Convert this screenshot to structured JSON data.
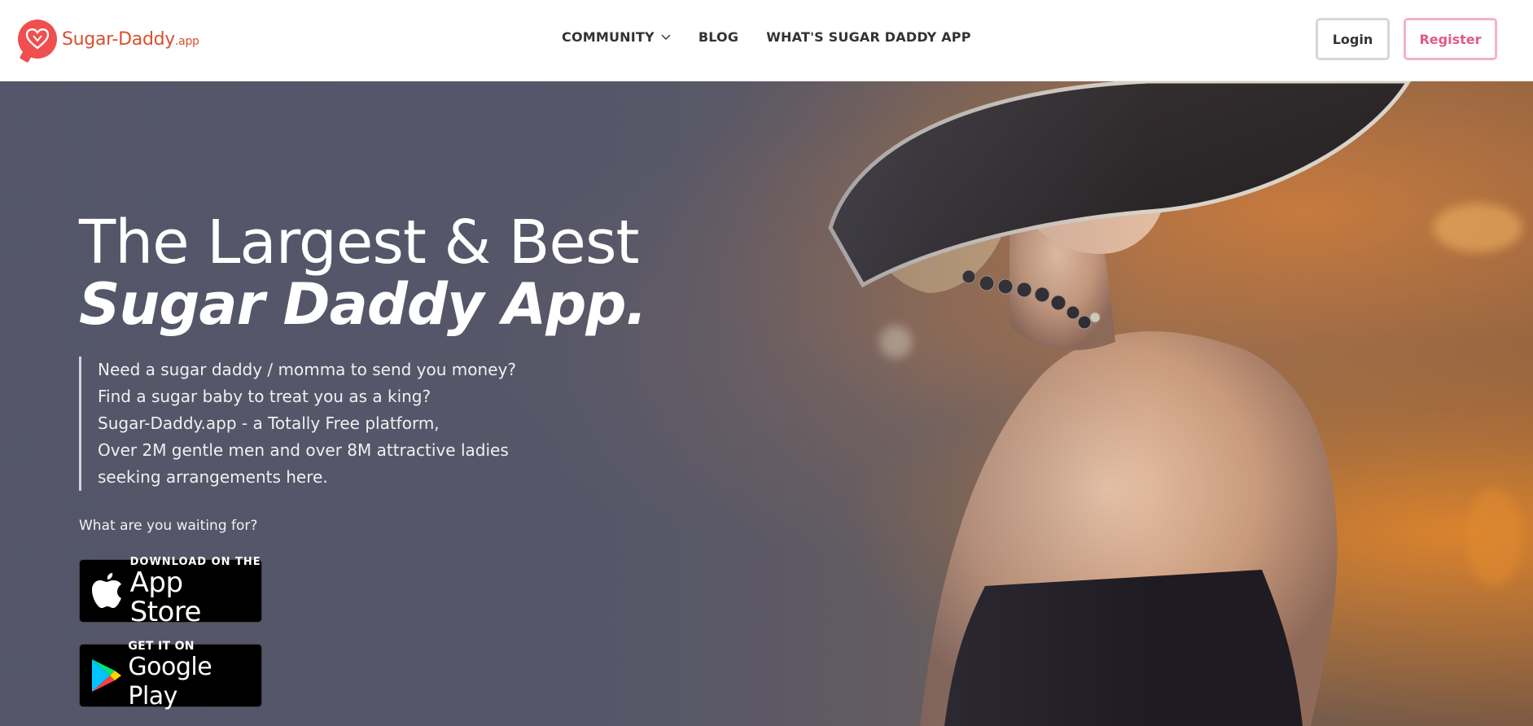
{
  "header": {
    "logo": {
      "name": "Sugar-Daddy",
      "tld": ".app"
    },
    "nav": [
      {
        "label": "COMMUNITY",
        "has_dropdown": true
      },
      {
        "label": "BLOG",
        "has_dropdown": false
      },
      {
        "label": "WHAT'S SUGAR DADDY APP",
        "has_dropdown": false
      }
    ],
    "login_label": "Login",
    "register_label": "Register"
  },
  "hero": {
    "headline_line1": "The Largest & Best",
    "headline_line2": "Sugar Daddy App.",
    "description": [
      "Need a sugar daddy / momma to send you money?",
      "Find a sugar baby to treat you as a king?",
      "Sugar-Daddy.app - a Totally Free platform,",
      "Over 2M gentle men and over 8M attractive ladies",
      "seeking arrangements here."
    ],
    "prompt": "What are you waiting for?",
    "app_store": {
      "small": "DOWNLOAD ON THE",
      "big": "App Store",
      "icon": "apple-icon"
    },
    "google_play": {
      "small": "GET IT ON",
      "big": "Google Play",
      "icon": "google-play-icon"
    }
  },
  "colors": {
    "brand": "#ef4f4f",
    "register_accent": "#e2588a",
    "hero_overlay": "#555669"
  }
}
